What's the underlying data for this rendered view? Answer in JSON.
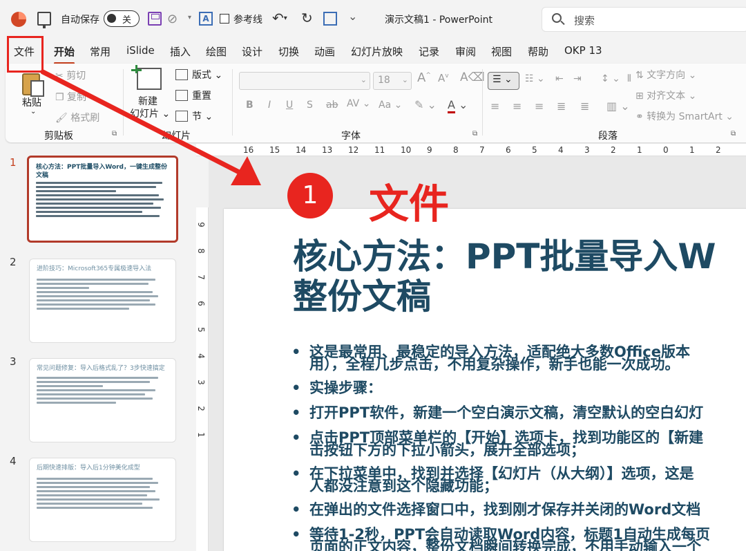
{
  "titlebar": {
    "autosave_label": "自动保存",
    "toggle_state": "关",
    "guides_label": "参考线",
    "doc_title": "演示文稿1 - PowerPoint",
    "search_placeholder": "搜索"
  },
  "tabs": [
    "文件",
    "开始",
    "常用",
    "iSlide",
    "插入",
    "绘图",
    "设计",
    "切换",
    "动画",
    "幻灯片放映",
    "记录",
    "审阅",
    "视图",
    "帮助",
    "OKP 13"
  ],
  "active_tab": "开始",
  "ribbon": {
    "clipboard": {
      "paste": "粘贴",
      "cut": "剪切",
      "copy": "复制",
      "format_painter": "格式刷",
      "group": "剪贴板"
    },
    "slides": {
      "new_slide_line1": "新建",
      "new_slide_line2": "幻灯片",
      "layout": "版式",
      "reset": "重置",
      "section": "节",
      "group": "幻灯片"
    },
    "font": {
      "size": "18",
      "group": "字体",
      "bold": "B",
      "italic": "I",
      "underline": "U",
      "shadow": "S",
      "strike": "ab",
      "spacing": "AV",
      "case": "Aa",
      "grow": "A",
      "shrink": "A"
    },
    "paragraph": {
      "text_direction": "文字方向",
      "align_text": "对齐文本",
      "smartart": "转换为 SmartArt",
      "group": "段落"
    }
  },
  "ruler": {
    "h_ticks": [
      "16",
      "15",
      "14",
      "13",
      "12",
      "11",
      "10",
      "9",
      "8",
      "7",
      "6",
      "5",
      "4",
      "3",
      "2",
      "1",
      "0",
      "1",
      "2"
    ],
    "v_ticks": [
      "9",
      "8",
      "7",
      "6",
      "5",
      "4",
      "3",
      "2",
      "1"
    ]
  },
  "thumbnails": [
    {
      "num": "1",
      "title": "核心方法：PPT批量导入Word，一键生成整份文稿"
    },
    {
      "num": "2",
      "title": "进阶技巧：Microsoft365专属极速导入法"
    },
    {
      "num": "3",
      "title": "常见问题修复：导入后格式乱了？3步快速搞定"
    },
    {
      "num": "4",
      "title": "后期快速排版：导入后1分钟美化成型"
    }
  ],
  "slide": {
    "title_line1": "核心方法：PPT批量导入W",
    "title_line2": "整份文稿",
    "bullets": [
      {
        "l1": "这是最常用、最稳定的导入方法，适配绝大多数Office版本",
        "l2": "用），全程几步点击，不用复杂操作，新手也能一次成功。"
      },
      {
        "l1": "实操步骤：",
        "l2": ""
      },
      {
        "l1": "打开PPT软件，新建一个空白演示文稿，清空默认的空白幻灯",
        "l2": ""
      },
      {
        "l1": "点击PPT顶部菜单栏的【开始】选项卡，找到功能区的【新建",
        "l2": "击按钮下方的下拉小箭头，展开全部选项；"
      },
      {
        "l1": "在下拉菜单中，找到并选择【幻灯片（从大纲）】选项，这是",
        "l2": "人都没注意到这个隐藏功能；"
      },
      {
        "l1": "在弹出的文件选择窗口中，找到刚才保存并关闭的Word文档",
        "l2": ""
      },
      {
        "l1": "等待1-2秒，PPT会自动读取Word内容，标题1自动生成每页",
        "l2": "页面的正文内容，整份文档瞬间转换完成，不用手动输入一个"
      }
    ]
  },
  "annotation": {
    "badge": "1",
    "label": "文件"
  },
  "colors": {
    "accent": "#c43e1c",
    "annotation_red": "#e8251f",
    "slide_text": "#1e4a63"
  }
}
